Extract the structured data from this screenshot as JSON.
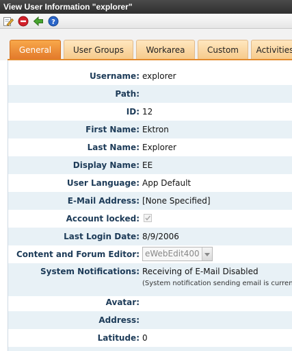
{
  "window": {
    "title": "View User Information \"explorer\""
  },
  "toolbar": {
    "icons": [
      "edit-icon",
      "delete-icon",
      "back-icon",
      "help-icon"
    ],
    "colors": {
      "edit": "#d59a23",
      "delete": "#d3202a",
      "back": "#48a52f",
      "help": "#2b66c9"
    }
  },
  "tabs": [
    {
      "label": "General",
      "active": true
    },
    {
      "label": "User Groups",
      "active": false
    },
    {
      "label": "Workarea",
      "active": false
    },
    {
      "label": "Custom",
      "active": false
    },
    {
      "label": "Activities",
      "active": false
    }
  ],
  "fields": {
    "username": {
      "label": "Username:",
      "value": "explorer"
    },
    "path": {
      "label": "Path:",
      "value": ""
    },
    "id": {
      "label": "ID:",
      "value": "12"
    },
    "first_name": {
      "label": "First Name:",
      "value": "Ektron"
    },
    "last_name": {
      "label": "Last Name:",
      "value": "Explorer"
    },
    "display_name": {
      "label": "Display Name:",
      "value": "EE"
    },
    "user_language": {
      "label": "User Language:",
      "value": "App Default"
    },
    "email": {
      "label": "E-Mail Address:",
      "value": "[None Specified]"
    },
    "account_locked": {
      "label": "Account locked:",
      "checked": true,
      "disabled": true
    },
    "last_login": {
      "label": "Last Login Date:",
      "value": "8/9/2006"
    },
    "editor": {
      "label": "Content and Forum Editor:",
      "value": "eWebEdit400",
      "disabled": true
    },
    "notifications": {
      "label": "System Notifications:",
      "value": "Receiving of E-Mail Disabled",
      "note": "(System notification sending email is currently disabled)"
    },
    "avatar": {
      "label": "Avatar:",
      "value": ""
    },
    "address": {
      "label": "Address:",
      "value": ""
    },
    "latitude": {
      "label": "Latitude:",
      "value": "0"
    }
  }
}
